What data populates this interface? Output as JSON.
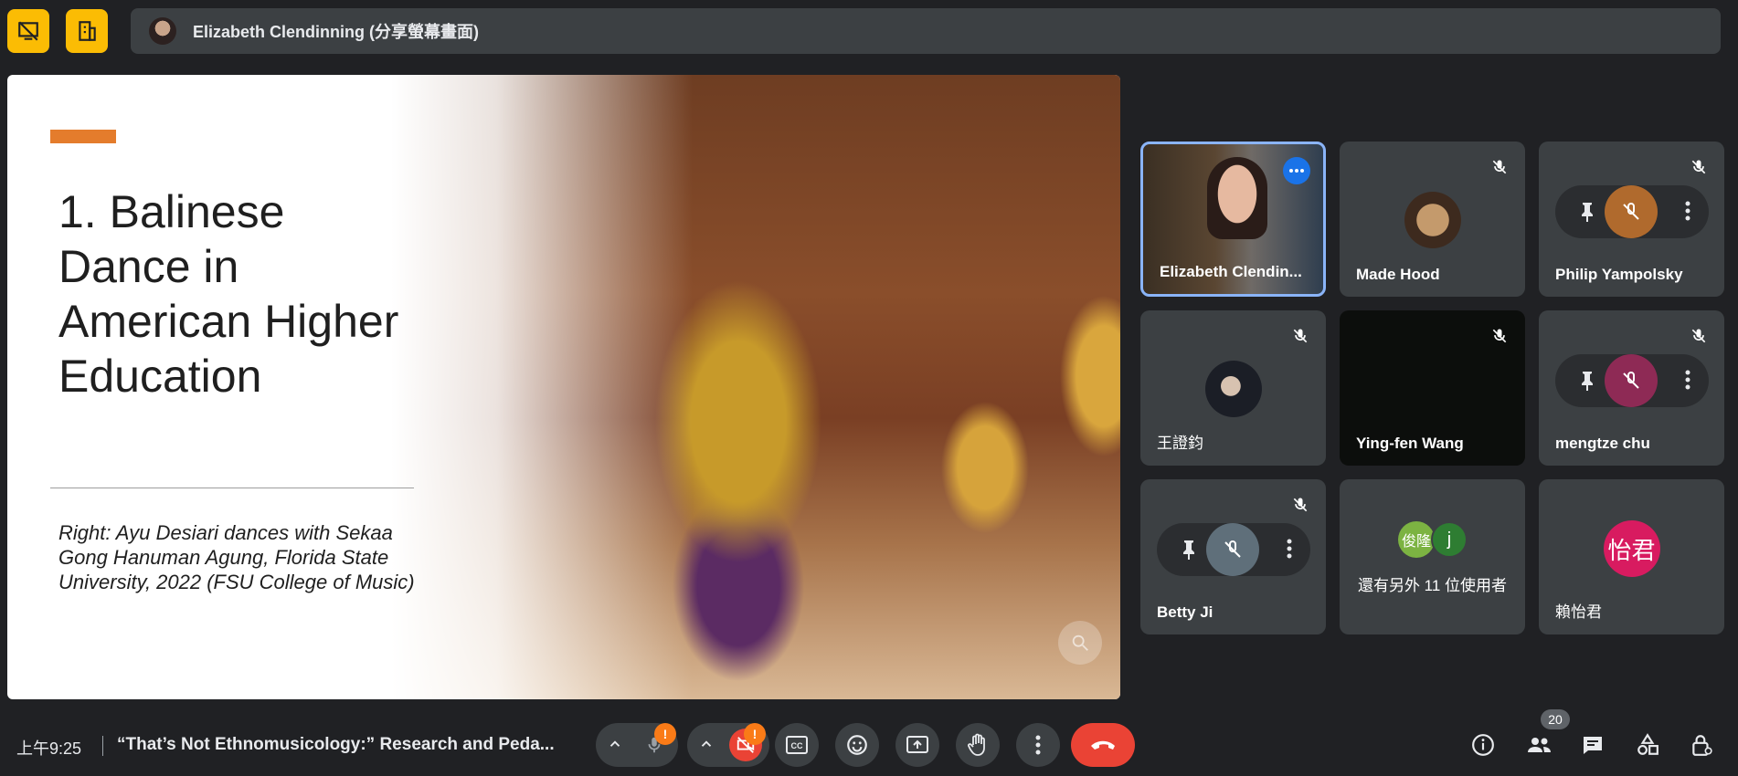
{
  "top_bar": {
    "presenter_label": "Elizabeth Clendinning (分享螢幕畫面)",
    "left_buttons": [
      "presentation-off-icon",
      "companion-mode-icon"
    ],
    "button_color": "#fbbc04"
  },
  "slide": {
    "title": "1. Balinese Dance in American Higher Education",
    "caption": "Right: Ayu Desiari dances with Sekaa Gong Hanuman Agung, Florida State University, 2022 (FSU College of Music)",
    "accent_color": "#e47c2c"
  },
  "participants": [
    {
      "name": "Elizabeth Clendin...",
      "active": true
    },
    {
      "name": "Made Hood",
      "muted": true
    },
    {
      "name": "Philip Yampolsky",
      "muted": true
    },
    {
      "name": "王證鈞",
      "muted": true
    },
    {
      "name": "Ying-fen Wang",
      "muted": true
    },
    {
      "name": "mengtze chu",
      "muted": true
    },
    {
      "name": "Betty Ji",
      "muted": true
    },
    {
      "name": "還有另外 11 位使用者",
      "avatars": [
        "俊隆",
        "j"
      ]
    },
    {
      "name": "賴怡君",
      "initials": "怡君",
      "avatar_color": "#d81b60"
    }
  ],
  "bottom_bar": {
    "time": "上午9:25",
    "meeting_title": "“That’s Not Ethnomusicology:” Research and Peda...",
    "alert_badge": "!",
    "participant_count": "20",
    "hangup_color": "#ea4335"
  }
}
